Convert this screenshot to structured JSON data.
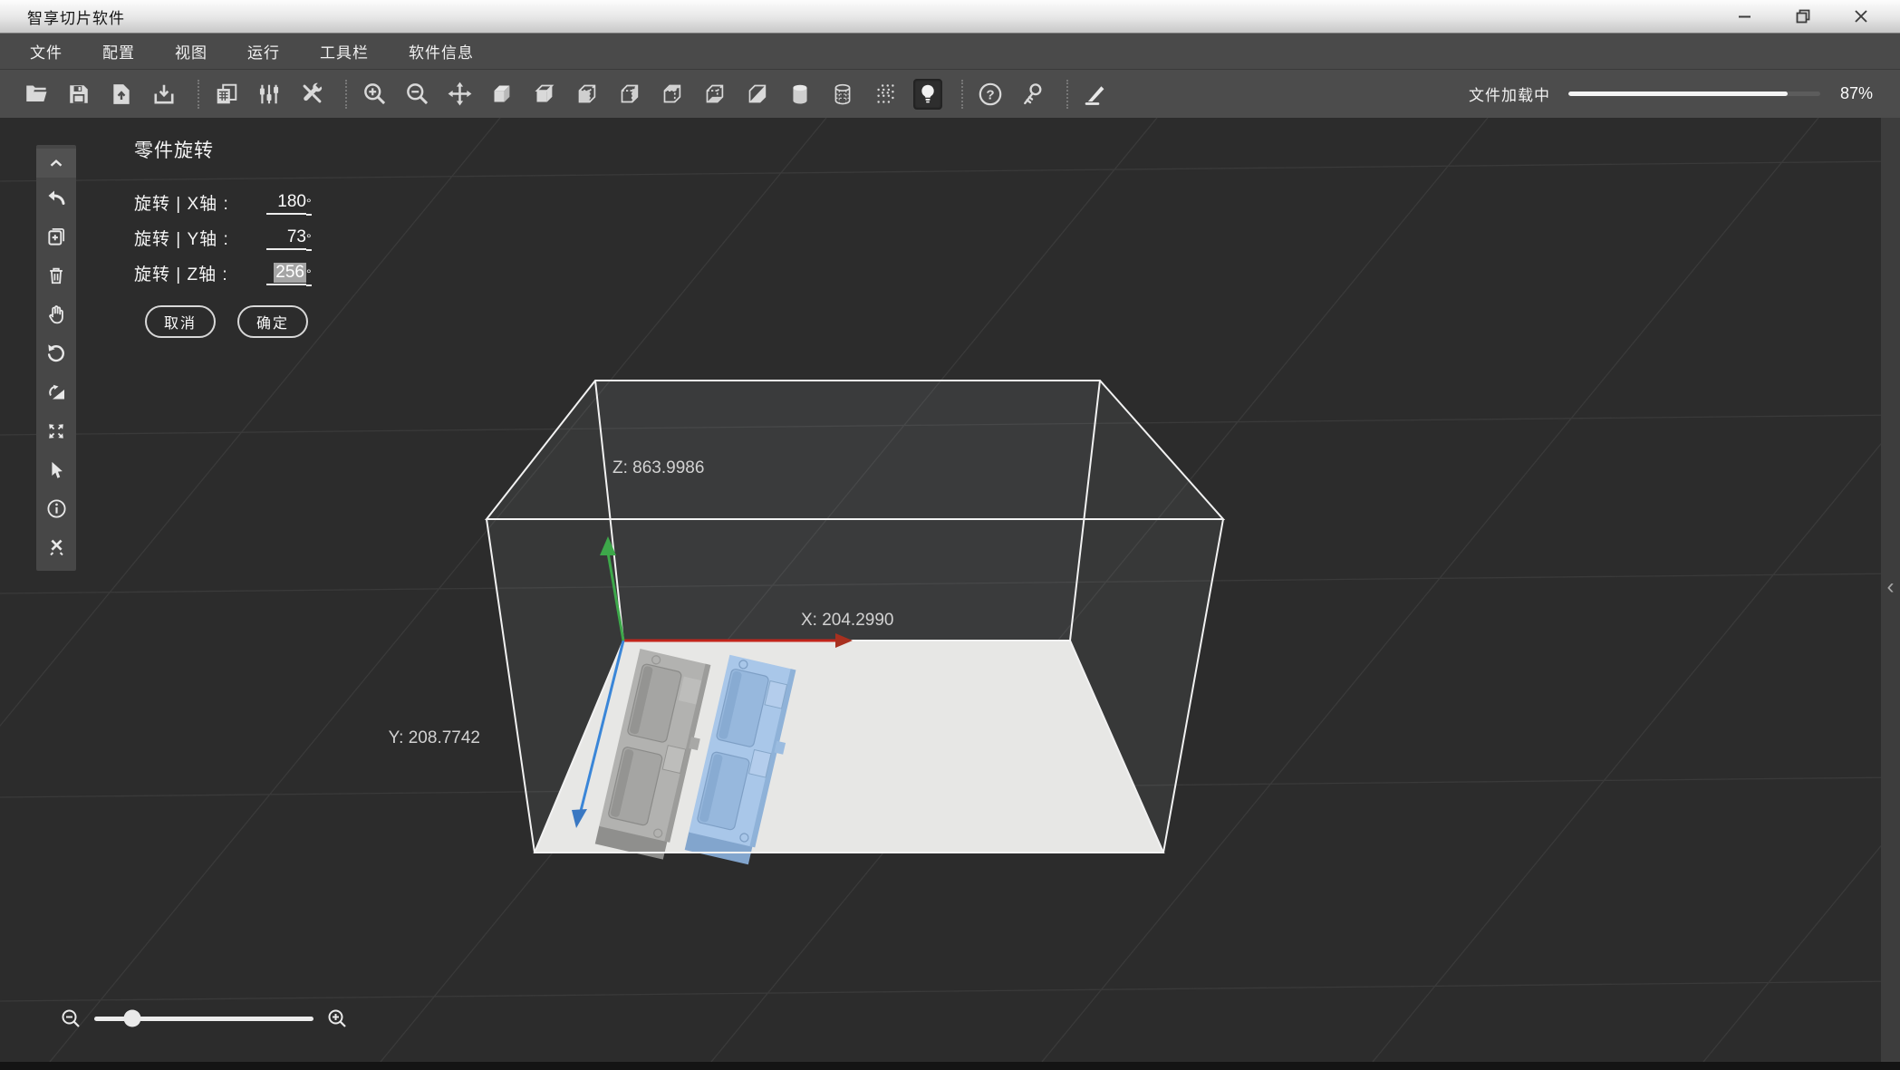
{
  "window": {
    "title": "智享切片软件",
    "controls": [
      "minimize",
      "restore",
      "close"
    ]
  },
  "menu": {
    "items": [
      {
        "label": "文件"
      },
      {
        "label": "配置"
      },
      {
        "label": "视图"
      },
      {
        "label": "运行"
      },
      {
        "label": "工具栏"
      },
      {
        "label": "软件信息"
      }
    ]
  },
  "toolbar": {
    "icons": [
      "open-file",
      "save-file",
      "import-file",
      "export-file",
      "duplicate",
      "parameter-sliders",
      "tools",
      "zoom-in",
      "zoom-out",
      "move",
      "view-solid",
      "view-shaded",
      "view-front-face",
      "view-right-face",
      "view-top-face",
      "view-bottom-face",
      "view-section",
      "cylinder-solid",
      "cylinder-wireframe",
      "point-cloud",
      "light-toggle",
      "help",
      "license-key",
      "cut"
    ],
    "active_icon": "light-toggle",
    "loading": {
      "label": "文件加载中",
      "percent": 87,
      "percent_label": "87%"
    }
  },
  "sidebar": {
    "tools": [
      "collapse-up",
      "undo",
      "add-duplicate",
      "delete",
      "pan",
      "rotate-view",
      "rotate-part",
      "fit-view",
      "select",
      "info",
      "repair"
    ]
  },
  "rotate_panel": {
    "title": "零件旋转",
    "rows": [
      {
        "label": "旋转 | X轴 :",
        "value": "180",
        "unit": "°",
        "selected": false
      },
      {
        "label": "旋转 | Y轴 :",
        "value": "73",
        "unit": "°",
        "selected": false
      },
      {
        "label": "旋转 | Z轴 :",
        "value": "256",
        "unit": "°",
        "selected": true
      }
    ],
    "cancel_label": "取消",
    "confirm_label": "确定"
  },
  "viewport": {
    "axes": {
      "x": {
        "label": "X: 204.2990",
        "color": "#c2251c"
      },
      "y": {
        "label": "Y: 208.7742",
        "color": "#3a86d8"
      },
      "z": {
        "label": "Z: 863.9986",
        "color": "#3da84a"
      }
    },
    "build_plate_color": "#e7e7e5",
    "models": [
      {
        "name": "mold-left",
        "color": "#b2b2b0"
      },
      {
        "name": "mold-right",
        "color": "#a9c7e9"
      }
    ],
    "right_panel_toggle": "‹"
  }
}
